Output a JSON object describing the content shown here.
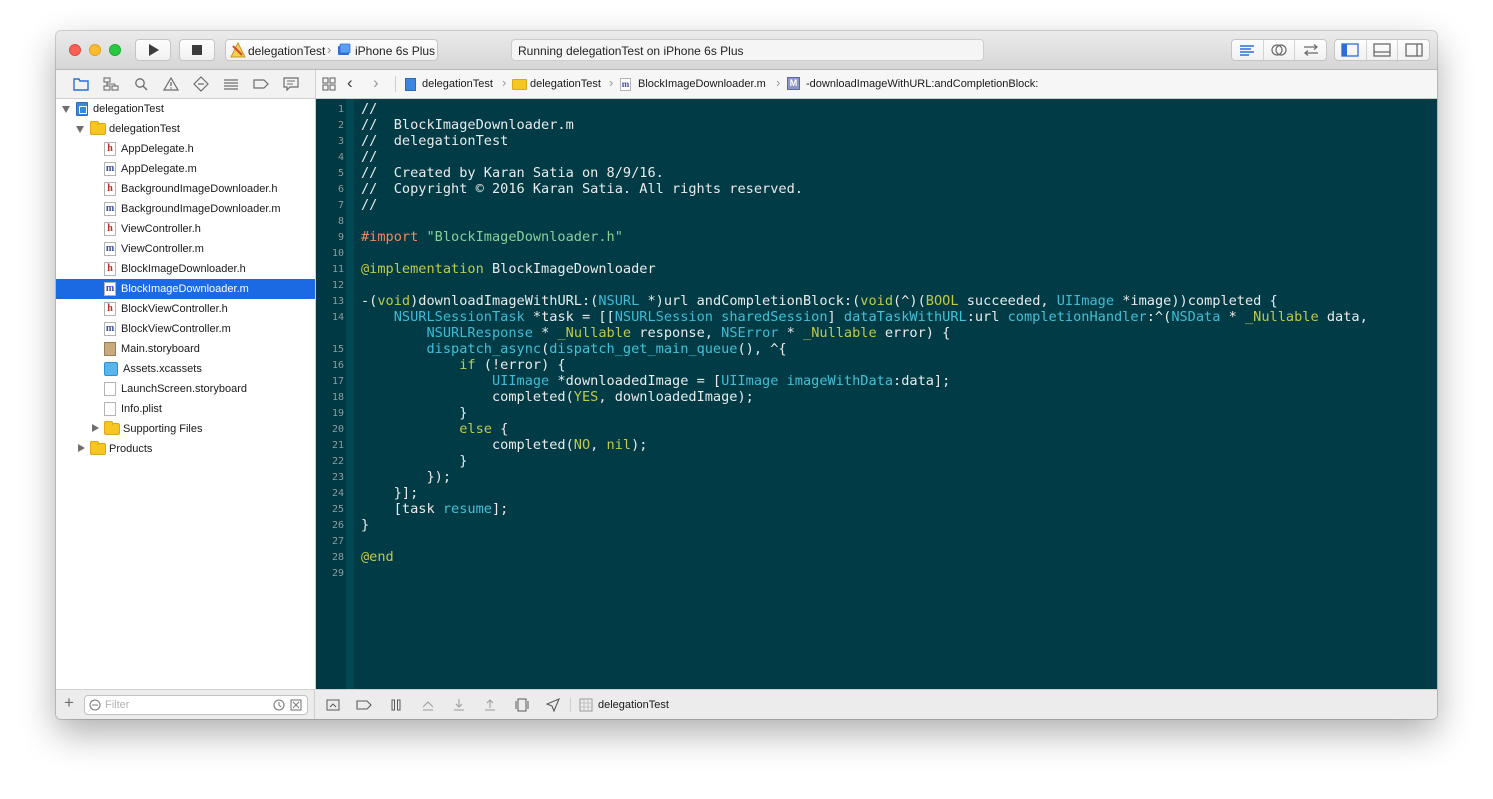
{
  "colors": {
    "editor_bg": "#003b46",
    "selection": "#1b6ae4",
    "keyword": "#c0c94a",
    "type": "#3fbcd4",
    "string": "#8bd09a",
    "preprocessor": "#f4865e"
  },
  "toolbar": {
    "run_icon": "play-icon",
    "stop_icon": "stop-icon",
    "scheme_name": "delegationTest",
    "device_name": "iPhone 6s Plus",
    "status_text": "Running delegationTest on iPhone 6s Plus"
  },
  "jumpbar": {
    "project": "delegationTest",
    "group": "delegationTest",
    "file": "BlockImageDownloader.m",
    "method_badge": "M",
    "method": "-downloadImageWithURL:andCompletionBlock:"
  },
  "navigator": {
    "items": [
      {
        "label": "delegationTest",
        "kind": "project",
        "indent": 0,
        "disclosure": "open"
      },
      {
        "label": "delegationTest",
        "kind": "folder",
        "indent": 1,
        "disclosure": "open"
      },
      {
        "label": "AppDelegate.h",
        "kind": "h",
        "indent": 2
      },
      {
        "label": "AppDelegate.m",
        "kind": "m",
        "indent": 2
      },
      {
        "label": "BackgroundImageDownloader.h",
        "kind": "h",
        "indent": 2
      },
      {
        "label": "BackgroundImageDownloader.m",
        "kind": "m",
        "indent": 2
      },
      {
        "label": "ViewController.h",
        "kind": "h",
        "indent": 2
      },
      {
        "label": "ViewController.m",
        "kind": "m",
        "indent": 2
      },
      {
        "label": "BlockImageDownloader.h",
        "kind": "h",
        "indent": 2
      },
      {
        "label": "BlockImageDownloader.m",
        "kind": "m",
        "indent": 2,
        "selected": true
      },
      {
        "label": "BlockViewController.h",
        "kind": "h",
        "indent": 2
      },
      {
        "label": "BlockViewController.m",
        "kind": "m",
        "indent": 2
      },
      {
        "label": "Main.storyboard",
        "kind": "storyboard",
        "indent": 2
      },
      {
        "label": "Assets.xcassets",
        "kind": "assets",
        "indent": 2
      },
      {
        "label": "LaunchScreen.storyboard",
        "kind": "doc",
        "indent": 2
      },
      {
        "label": "Info.plist",
        "kind": "doc",
        "indent": 2
      },
      {
        "label": "Supporting Files",
        "kind": "folder",
        "indent": 2,
        "disclosure": "closed"
      },
      {
        "label": "Products",
        "kind": "folder",
        "indent": 1,
        "disclosure": "closed"
      }
    ],
    "filter_placeholder": "Filter"
  },
  "editor": {
    "lines": [
      {
        "n": "1",
        "t": [
          [
            "//",
            "cm"
          ]
        ]
      },
      {
        "n": "2",
        "t": [
          [
            "//  BlockImageDownloader.m",
            "cm"
          ]
        ]
      },
      {
        "n": "3",
        "t": [
          [
            "//  delegationTest",
            "cm"
          ]
        ]
      },
      {
        "n": "4",
        "t": [
          [
            "//",
            "cm"
          ]
        ]
      },
      {
        "n": "5",
        "t": [
          [
            "//  Created by Karan Satia on 8/9/16.",
            "cm"
          ]
        ]
      },
      {
        "n": "6",
        "t": [
          [
            "//  Copyright © 2016 Karan Satia. All rights reserved.",
            "cm"
          ]
        ]
      },
      {
        "n": "7",
        "t": [
          [
            "//",
            "cm"
          ]
        ]
      },
      {
        "n": "8",
        "t": []
      },
      {
        "n": "9",
        "t": [
          [
            "#import ",
            "pp"
          ],
          [
            "\"BlockImageDownloader.h\"",
            "st"
          ]
        ]
      },
      {
        "n": "10",
        "t": []
      },
      {
        "n": "11",
        "t": [
          [
            "@implementation",
            "kw"
          ],
          [
            " BlockImageDownloader",
            ""
          ]
        ]
      },
      {
        "n": "12",
        "t": []
      },
      {
        "n": "13",
        "t": [
          [
            "-(",
            ""
          ],
          [
            "void",
            "kw"
          ],
          [
            ")downloadImageWithURL:(",
            ""
          ],
          [
            "NSURL",
            "ty"
          ],
          [
            " *)url andCompletionBlock:(",
            ""
          ],
          [
            "void",
            "kw"
          ],
          [
            "(^)(",
            ""
          ],
          [
            "BOOL",
            "kw"
          ],
          [
            " succeeded, ",
            ""
          ],
          [
            "UIImage",
            "ty"
          ],
          [
            " *image))completed {",
            ""
          ]
        ]
      },
      {
        "n": "14",
        "t": [
          [
            "    ",
            ""
          ],
          [
            "NSURLSessionTask",
            "ty"
          ],
          [
            " *task = [[",
            ""
          ],
          [
            "NSURLSession",
            "ty"
          ],
          [
            " ",
            ""
          ],
          [
            "sharedSession",
            "me"
          ],
          [
            "] ",
            ""
          ],
          [
            "dataTaskWithURL",
            "me"
          ],
          [
            ":url ",
            ""
          ],
          [
            "completionHandler",
            "me"
          ],
          [
            ":^(",
            ""
          ],
          [
            "NSData",
            "ty"
          ],
          [
            " * ",
            ""
          ],
          [
            "_Nullable",
            "kw"
          ],
          [
            " data,",
            ""
          ]
        ]
      },
      {
        "n": "",
        "t": [
          [
            "        ",
            ""
          ],
          [
            "NSURLResponse",
            "ty"
          ],
          [
            " * ",
            ""
          ],
          [
            "_Nullable",
            "kw"
          ],
          [
            " response, ",
            ""
          ],
          [
            "NSError",
            "ty"
          ],
          [
            " * ",
            ""
          ],
          [
            "_Nullable",
            "kw"
          ],
          [
            " error) {",
            ""
          ]
        ]
      },
      {
        "n": "15",
        "t": [
          [
            "        ",
            ""
          ],
          [
            "dispatch_async",
            "me"
          ],
          [
            "(",
            ""
          ],
          [
            "dispatch_get_main_queue",
            "me"
          ],
          [
            "(), ^{",
            ""
          ]
        ]
      },
      {
        "n": "16",
        "t": [
          [
            "            ",
            ""
          ],
          [
            "if",
            "kw"
          ],
          [
            " (!error) {",
            ""
          ]
        ]
      },
      {
        "n": "17",
        "t": [
          [
            "                ",
            ""
          ],
          [
            "UIImage",
            "ty"
          ],
          [
            " *downloadedImage = [",
            ""
          ],
          [
            "UIImage",
            "ty"
          ],
          [
            " ",
            ""
          ],
          [
            "imageWithData",
            "me"
          ],
          [
            ":data];",
            ""
          ]
        ]
      },
      {
        "n": "18",
        "t": [
          [
            "                completed(",
            ""
          ],
          [
            "YES",
            "kw"
          ],
          [
            ", downloadedImage);",
            ""
          ]
        ]
      },
      {
        "n": "19",
        "t": [
          [
            "            }",
            ""
          ]
        ]
      },
      {
        "n": "20",
        "t": [
          [
            "            ",
            ""
          ],
          [
            "else",
            "kw"
          ],
          [
            " {",
            ""
          ]
        ]
      },
      {
        "n": "21",
        "t": [
          [
            "                completed(",
            ""
          ],
          [
            "NO",
            "kw"
          ],
          [
            ", ",
            ""
          ],
          [
            "nil",
            "kw"
          ],
          [
            ");",
            ""
          ]
        ]
      },
      {
        "n": "22",
        "t": [
          [
            "            }",
            ""
          ]
        ]
      },
      {
        "n": "23",
        "t": [
          [
            "        });",
            ""
          ]
        ]
      },
      {
        "n": "24",
        "t": [
          [
            "    }];",
            ""
          ]
        ]
      },
      {
        "n": "25",
        "t": [
          [
            "    [task ",
            ""
          ],
          [
            "resume",
            "me"
          ],
          [
            "];",
            ""
          ]
        ]
      },
      {
        "n": "26",
        "t": [
          [
            "}",
            ""
          ]
        ]
      },
      {
        "n": "27",
        "t": []
      },
      {
        "n": "28",
        "t": [
          [
            "@end",
            "kw"
          ]
        ]
      },
      {
        "n": "29",
        "t": []
      }
    ]
  },
  "debugbar": {
    "target": "delegationTest"
  }
}
